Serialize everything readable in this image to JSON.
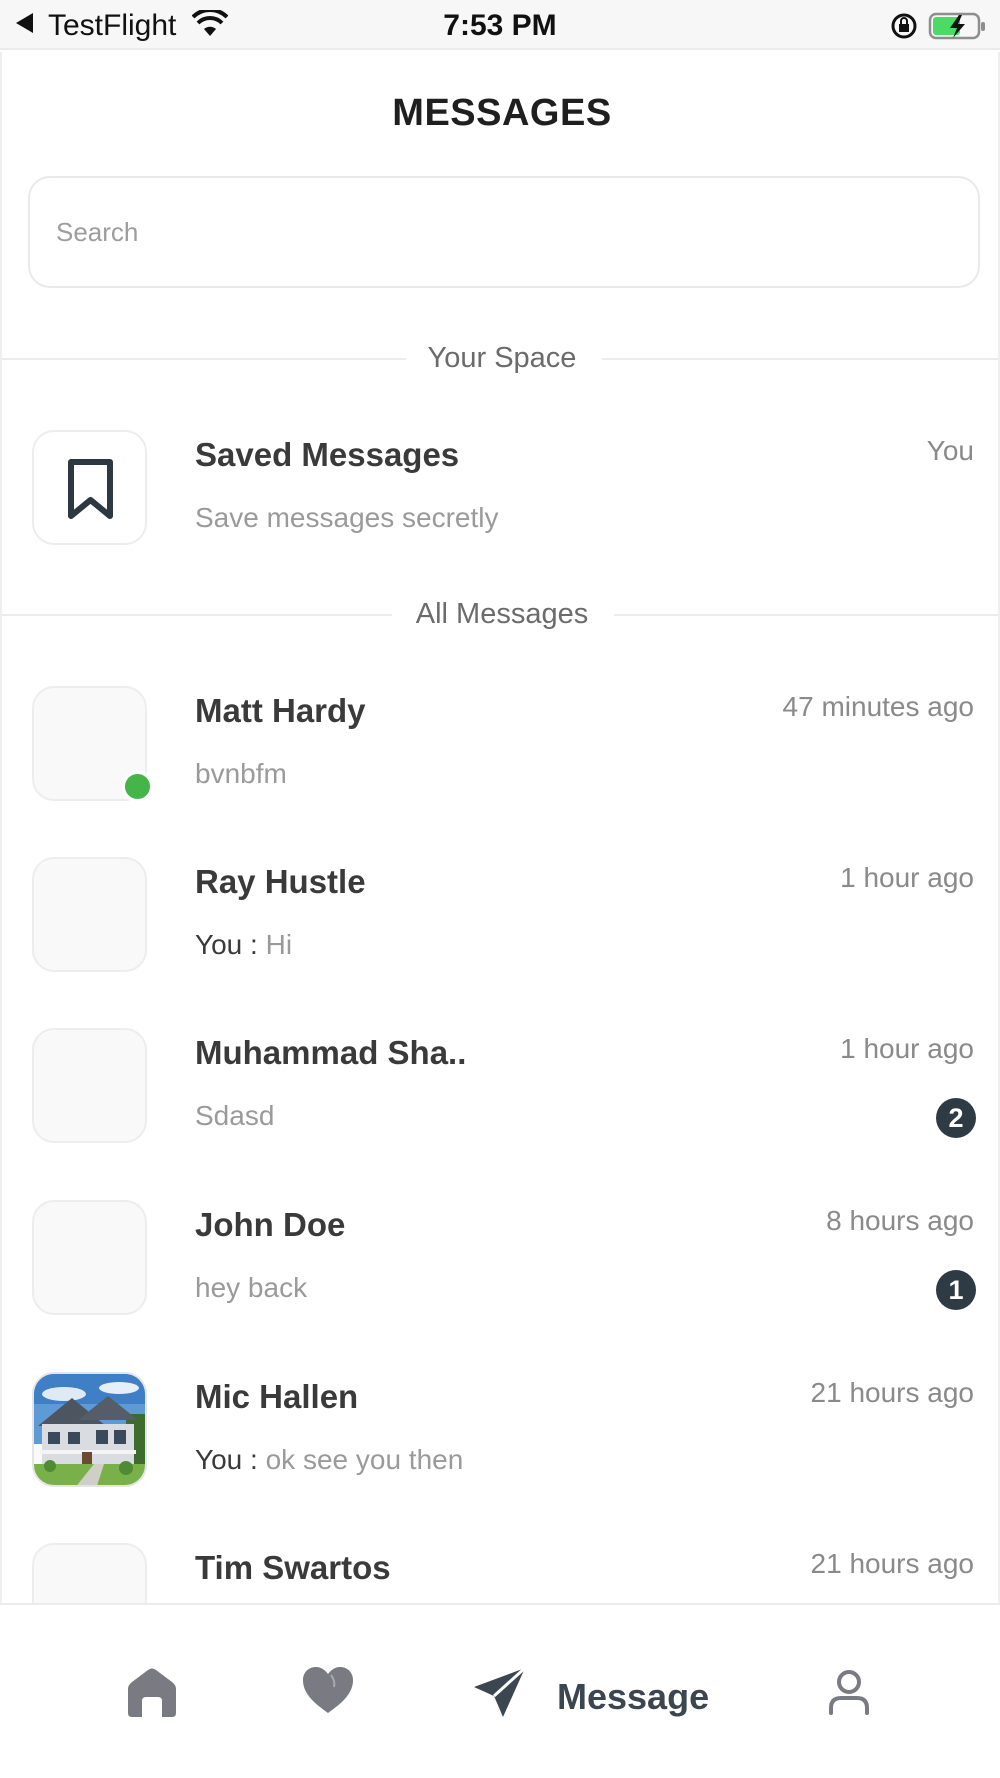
{
  "status_bar": {
    "carrier": "TestFlight",
    "time": "7:53 PM"
  },
  "header": {
    "title": "MESSAGES"
  },
  "search": {
    "placeholder": "Search",
    "value": ""
  },
  "sections": {
    "your_space": "Your Space",
    "all_messages": "All Messages"
  },
  "saved": {
    "title": "Saved Messages",
    "subtitle": "Save messages secretly",
    "meta": "You"
  },
  "conversations": [
    {
      "name": "Matt Hardy",
      "time": "47 minutes ago",
      "sender": "",
      "message": "bvnbfm",
      "unread": "",
      "online": true
    },
    {
      "name": "Ray Hustle",
      "time": "1 hour ago",
      "sender": "You : ",
      "message": "Hi",
      "unread": "",
      "online": false
    },
    {
      "name": "Muhammad Sha..",
      "time": "1 hour ago",
      "sender": "",
      "message": "Sdasd",
      "unread": "2",
      "online": false
    },
    {
      "name": "John Doe",
      "time": "8 hours ago",
      "sender": "",
      "message": "hey back",
      "unread": "1",
      "online": false
    },
    {
      "name": "Mic Hallen",
      "time": "21 hours ago",
      "sender": "You : ",
      "message": "ok see you then",
      "unread": "",
      "online": false
    },
    {
      "name": "Tim Swartos",
      "time": "21 hours ago",
      "sender": "",
      "message": "",
      "unread": "",
      "online": false
    }
  ],
  "tabbar": {
    "active_label": "Message",
    "items": [
      "home-icon",
      "heart-icon",
      "send-icon",
      "profile-icon"
    ]
  },
  "colors": {
    "online": "#45b449",
    "badge": "#2e3a44",
    "tab_active": "#3c4650",
    "tab_inactive": "#7a7a82"
  }
}
